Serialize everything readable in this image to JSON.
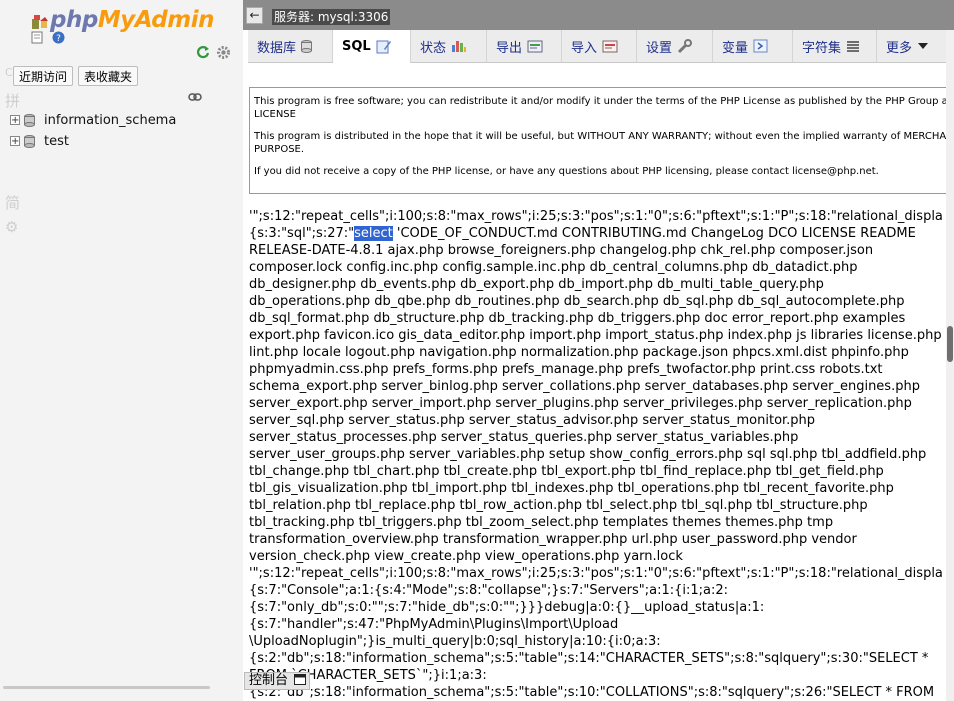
{
  "logo": {
    "php": "php",
    "admin": "MyAdmin"
  },
  "nav": {
    "recent_label": "近期访问",
    "favorites_label": "表收藏夹",
    "databases": [
      "information_schema",
      "test"
    ],
    "ghost_glyphs": [
      "CN",
      "拼",
      "简"
    ]
  },
  "topbar": {
    "back": "←",
    "server": "服务器: mysql:3306"
  },
  "tabs": [
    {
      "label": "数据库",
      "icon": "database-icon"
    },
    {
      "label": "SQL",
      "icon": "sql-icon"
    },
    {
      "label": "状态",
      "icon": "status-icon"
    },
    {
      "label": "导出",
      "icon": "export-icon"
    },
    {
      "label": "导入",
      "icon": "import-icon"
    },
    {
      "label": "设置",
      "icon": "settings-icon"
    },
    {
      "label": "变量",
      "icon": "variables-icon"
    },
    {
      "label": "字符集",
      "icon": "charset-icon"
    },
    {
      "label": "更多",
      "icon": "chevron-down-icon"
    }
  ],
  "license": [
    "This program is free software; you can redistribute it and/or modify it under the terms of the PHP License as published by the PHP Group and",
    "LICENSE",
    "This program is distributed in the hope that it will be useful, but WITHOUT ANY WARRANTY; without even the implied warranty of MERCHANT",
    "PURPOSE.",
    "If you did not receive a copy of the PHP license, or have any questions about PHP licensing, please contact license@php.net."
  ],
  "dump": {
    "line1": "'\";s:12:\"repeat_cells\";i:100;s:8:\"max_rows\";i:25;s:3:\"pos\";s:1:\"0\";s:6:\"pftext\";s:1:\"P\";s:18:\"relational_displa",
    "line2_pre": "{s:3:\"sql\";s:27:\"",
    "line2_sel": "select",
    "line2_post": " 'CODE_OF_CONDUCT.md CONTRIBUTING.md ChangeLog DCO LICENSE README",
    "lines": [
      "RELEASE-DATE-4.8.1 ajax.php browse_foreigners.php changelog.php chk_rel.php composer.json",
      "composer.lock config.inc.php config.sample.inc.php db_central_columns.php db_datadict.php",
      "db_designer.php db_events.php db_export.php db_import.php db_multi_table_query.php",
      "db_operations.php db_qbe.php db_routines.php db_search.php db_sql.php db_sql_autocomplete.php",
      "db_sql_format.php db_structure.php db_tracking.php db_triggers.php doc error_report.php examples",
      "export.php favicon.ico gis_data_editor.php import.php import_status.php index.php js libraries license.php",
      "lint.php locale logout.php navigation.php normalization.php package.json phpcs.xml.dist phpinfo.php",
      "phpmyadmin.css.php prefs_forms.php prefs_manage.php prefs_twofactor.php print.css robots.txt",
      "schema_export.php server_binlog.php server_collations.php server_databases.php server_engines.php",
      "server_export.php server_import.php server_plugins.php server_privileges.php server_replication.php",
      "server_sql.php server_status.php server_status_advisor.php server_status_monitor.php",
      "server_status_processes.php server_status_queries.php server_status_variables.php",
      "server_user_groups.php server_variables.php setup show_config_errors.php sql sql.php tbl_addfield.php",
      "tbl_change.php tbl_chart.php tbl_create.php tbl_export.php tbl_find_replace.php tbl_get_field.php",
      "tbl_gis_visualization.php tbl_import.php tbl_indexes.php tbl_operations.php tbl_recent_favorite.php",
      "tbl_relation.php tbl_replace.php tbl_row_action.php tbl_select.php tbl_sql.php tbl_structure.php",
      "tbl_tracking.php tbl_triggers.php tbl_zoom_select.php templates themes themes.php tmp",
      "transformation_overview.php transformation_wrapper.php url.php user_password.php vendor",
      "version_check.php view_create.php view_operations.php yarn.lock",
      "'\";s:12:\"repeat_cells\";i:100;s:8:\"max_rows\";i:25;s:3:\"pos\";s:1:\"0\";s:6:\"pftext\";s:1:\"P\";s:18:\"relational_displa",
      "{s:7:\"Console\";a:1:{s:4:\"Mode\";s:8:\"collapse\";}s:7:\"Servers\";a:1:{i:1;a:2:",
      "{s:7:\"only_db\";s:0:\"\";s:7:\"hide_db\";s:0:\"\";}}}debug|a:0:{}__upload_status|a:1:",
      "{s:7:\"handler\";s:47:\"PhpMyAdmin\\Plugins\\Import\\Upload",
      "\\UploadNoplugin\";}is_multi_query|b:0;sql_history|a:10:{i:0;a:3:",
      "{s:2:\"db\";s:18:\"information_schema\";s:5:\"table\";s:14:\"CHARACTER_SETS\";s:8:\"sqlquery\";s:30:\"SELECT *",
      "FROM `CHARACTER_SETS`\";}i:1;a:3:",
      "{s:2:\"db\";s:18:\"information_schema\";s:5:\"table\";s:10:\"COLLATIONS\";s:8:\"sqlquery\";s:26:\"SELECT * FROM"
    ]
  },
  "console": {
    "label": "控制台"
  }
}
